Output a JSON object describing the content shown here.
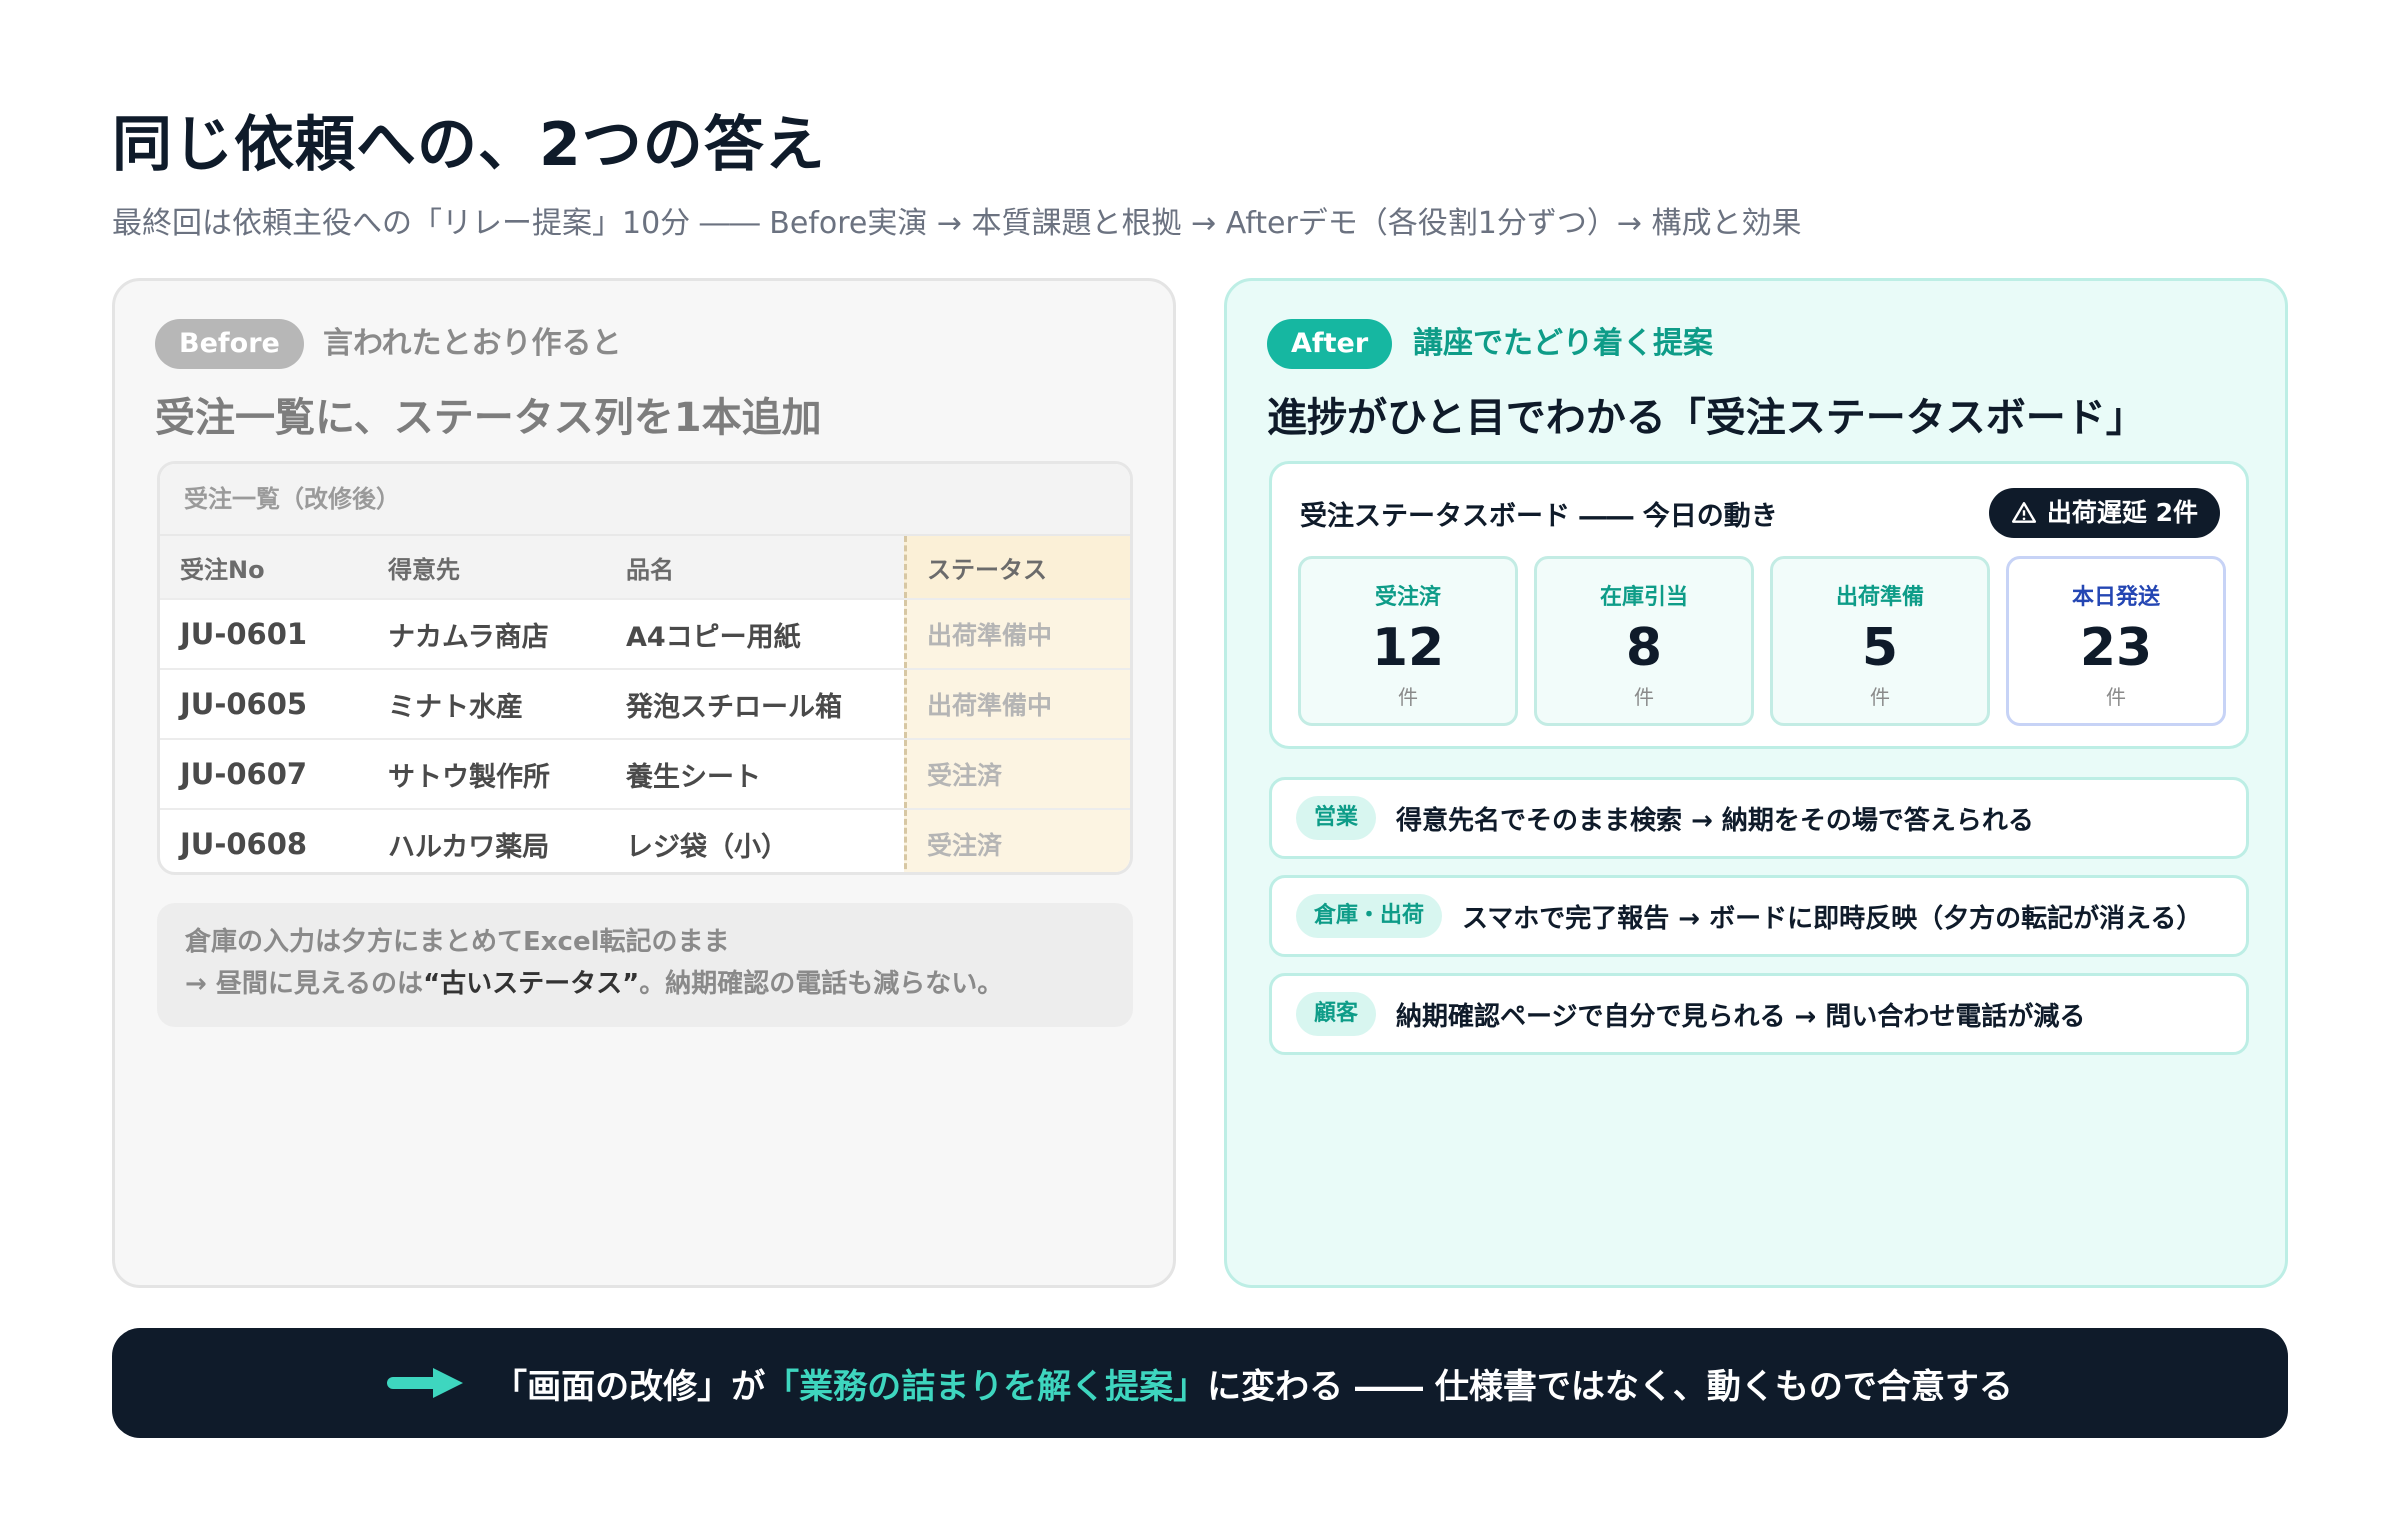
{
  "title": "同じ依頼への、2つの答え",
  "subtitle": "最終回は依頼主役への「リレー提案」10分 ―― Before実演 → 本質課題と根拠 → Afterデモ（各役割1分ずつ）→ 構成と効果",
  "before": {
    "badge": "Before",
    "tagline": "言われたとおり作ると",
    "heading": "受注一覧に、ステータス列を1本追加",
    "table": {
      "caption": "受注一覧（改修後）",
      "headers": [
        "受注No",
        "得意先",
        "品名",
        "ステータス"
      ],
      "rows": [
        [
          "JU-0601",
          "ナカムラ商店",
          "A4コピー用紙",
          "出荷準備中"
        ],
        [
          "JU-0605",
          "ミナト水産",
          "発泡スチロール箱",
          "出荷準備中"
        ],
        [
          "JU-0607",
          "サトウ製作所",
          "養生シート",
          "受注済"
        ],
        [
          "JU-0608",
          "ハルカワ薬局",
          "レジ袋（小）",
          "受注済"
        ]
      ]
    },
    "note": {
      "line1": "倉庫の入力は夕方にまとめてExcel転記のまま",
      "line2_pre": "→ 昼間に見えるのは",
      "line2_bold": "“古いステータス”",
      "line2_post": "。納期確認の電話も減らない。"
    }
  },
  "after": {
    "badge": "After",
    "tagline": "講座でたどり着く提案",
    "heading": "進捗がひと目でわかる「受注ステータスボード」",
    "board": {
      "title": "受注ステータスボード ―― 今日の動き",
      "alert": "出荷遅延 2件",
      "alert_icon": "warning-icon",
      "stats": [
        {
          "label": "受注済",
          "value": "12",
          "unit": "件"
        },
        {
          "label": "在庫引当",
          "value": "8",
          "unit": "件"
        },
        {
          "label": "出荷準備",
          "value": "5",
          "unit": "件"
        },
        {
          "label": "本日発送",
          "value": "23",
          "unit": "件"
        }
      ]
    },
    "roles": [
      {
        "role": "営業",
        "text": "得意先名でそのまま検索 → 納期をその場で答えられる"
      },
      {
        "role": "倉庫・出荷",
        "text": "スマホで完了報告 → ボードに即時反映（夕方の転記が消える）"
      },
      {
        "role": "顧客",
        "text": "納期確認ページで自分で見られる → 問い合わせ電話が減る"
      }
    ]
  },
  "banner": {
    "pre": "「画面の改修」が",
    "accent": "「業務の詰まりを解く提案」",
    "post": "に変わる ―― 仕様書ではなく、動くもので合意する"
  },
  "colors": {
    "navy": "#0f1b2a",
    "teal": "#16b7a1",
    "mint_bg": "#e9fbf8",
    "gray_badge": "#b7b7b7"
  }
}
